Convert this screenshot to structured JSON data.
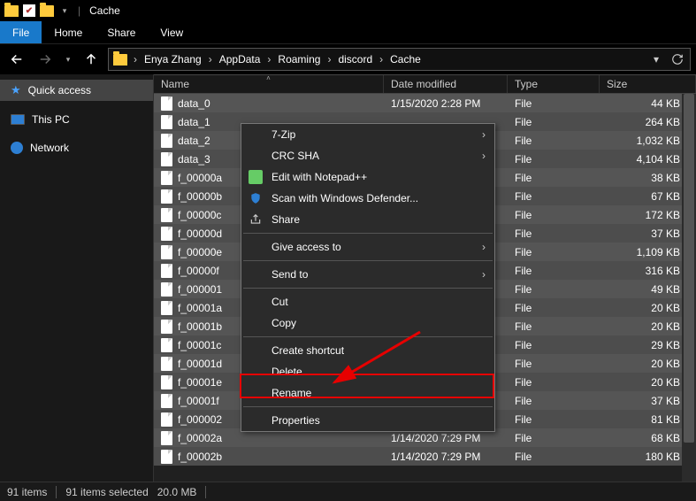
{
  "window": {
    "title": "Cache"
  },
  "ribbon": {
    "file": "File",
    "home": "Home",
    "share": "Share",
    "view": "View"
  },
  "breadcrumb": [
    "Enya Zhang",
    "AppData",
    "Roaming",
    "discord",
    "Cache"
  ],
  "columns": {
    "name": "Name",
    "date": "Date modified",
    "type": "Type",
    "size": "Size"
  },
  "sidebar": {
    "quick": "Quick access",
    "pc": "This PC",
    "network": "Network"
  },
  "files": [
    {
      "name": "data_0",
      "date": "1/15/2020 2:28 PM",
      "type": "File",
      "size": "44 KB"
    },
    {
      "name": "data_1",
      "date": "",
      "type": "File",
      "size": "264 KB"
    },
    {
      "name": "data_2",
      "date": "",
      "type": "File",
      "size": "1,032 KB"
    },
    {
      "name": "data_3",
      "date": "",
      "type": "File",
      "size": "4,104 KB"
    },
    {
      "name": "f_00000a",
      "date": "",
      "type": "File",
      "size": "38 KB"
    },
    {
      "name": "f_00000b",
      "date": "",
      "type": "File",
      "size": "67 KB"
    },
    {
      "name": "f_00000c",
      "date": "",
      "type": "File",
      "size": "172 KB"
    },
    {
      "name": "f_00000d",
      "date": "",
      "type": "File",
      "size": "37 KB"
    },
    {
      "name": "f_00000e",
      "date": "",
      "type": "File",
      "size": "1,109 KB"
    },
    {
      "name": "f_00000f",
      "date": "",
      "type": "File",
      "size": "316 KB"
    },
    {
      "name": "f_000001",
      "date": "",
      "type": "File",
      "size": "49 KB"
    },
    {
      "name": "f_00001a",
      "date": "",
      "type": "File",
      "size": "20 KB"
    },
    {
      "name": "f_00001b",
      "date": "",
      "type": "File",
      "size": "20 KB"
    },
    {
      "name": "f_00001c",
      "date": "",
      "type": "File",
      "size": "29 KB"
    },
    {
      "name": "f_00001d",
      "date": "",
      "type": "File",
      "size": "20 KB"
    },
    {
      "name": "f_00001e",
      "date": "",
      "type": "File",
      "size": "20 KB"
    },
    {
      "name": "f_00001f",
      "date": "",
      "type": "File",
      "size": "37 KB"
    },
    {
      "name": "f_000002",
      "date": "",
      "type": "File",
      "size": "81 KB"
    },
    {
      "name": "f_00002a",
      "date": "1/14/2020 7:29 PM",
      "type": "File",
      "size": "68 KB"
    },
    {
      "name": "f_00002b",
      "date": "1/14/2020 7:29 PM",
      "type": "File",
      "size": "180 KB"
    }
  ],
  "context_menu": {
    "sevenzip": "7-Zip",
    "crc": "CRC SHA",
    "notepad": "Edit with Notepad++",
    "defender": "Scan with Windows Defender...",
    "share": "Share",
    "give_access": "Give access to",
    "send_to": "Send to",
    "cut": "Cut",
    "copy": "Copy",
    "shortcut": "Create shortcut",
    "delete": "Delete",
    "rename": "Rename",
    "properties": "Properties"
  },
  "status": {
    "count": "91 items",
    "selected": "91 items selected",
    "size": "20.0 MB"
  },
  "colors": {
    "accent": "#1979ca",
    "highlight": "#e60000"
  }
}
